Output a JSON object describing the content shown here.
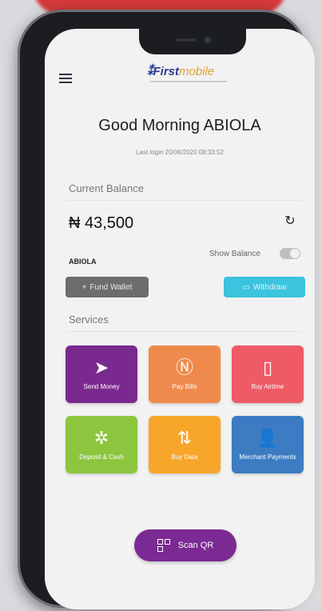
{
  "brand": {
    "first": "First",
    "mobile": "mobile"
  },
  "greeting": "Good Morning ABIOLA",
  "last_login": "Last login 20/06/2020 08:33:52",
  "balance": {
    "label": "Current Balance",
    "amount": "₦ 43,500",
    "account_name": "ABIOLA",
    "show_balance_label": "Show Balance"
  },
  "actions": {
    "fund_wallet": "Fund Wallet",
    "withdraw": "Withdraw"
  },
  "services": {
    "label": "Services",
    "items": [
      {
        "label": "Send Money",
        "icon": "paper-plane-icon",
        "color": "#7a2a8f"
      },
      {
        "label": "Pay Bills",
        "icon": "naira-coin-icon",
        "color": "#ef8a4c"
      },
      {
        "label": "Buy Airtime",
        "icon": "phone-icon",
        "color": "#ee5a66"
      },
      {
        "label": "Deposit & Cash",
        "icon": "cash-icon",
        "color": "#8cc63f"
      },
      {
        "label": "Buy Data",
        "icon": "arrows-updown-icon",
        "color": "#f7a62a"
      },
      {
        "label": "Merchant Payments",
        "icon": "merchant-icon",
        "color": "#3d7cc3"
      }
    ]
  },
  "scan": {
    "label": "Scan QR"
  }
}
